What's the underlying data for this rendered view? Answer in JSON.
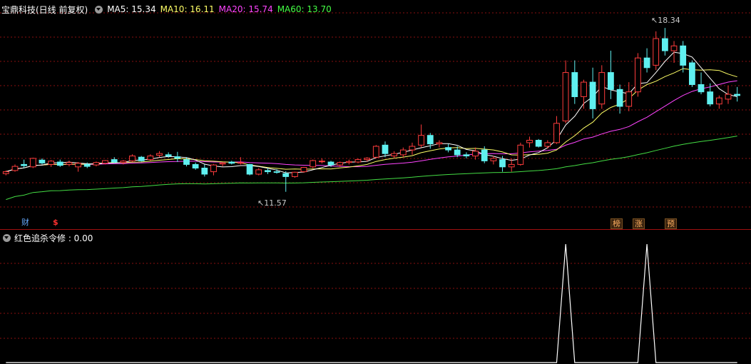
{
  "header": {
    "title": "宝鼎科技(日线 前复权)",
    "ma": [
      {
        "label": "MA5: 15.34",
        "color": "#ffffff"
      },
      {
        "label": "MA10: 16.11",
        "color": "#ffff66"
      },
      {
        "label": "MA20: 15.74",
        "color": "#ff44ff"
      },
      {
        "label": "MA60: 13.70",
        "color": "#44ff44"
      }
    ]
  },
  "annotations": {
    "high_label": "18.34",
    "low_label": "11.57",
    "bottom_markers": [
      {
        "text": "财",
        "color": "#66aaff",
        "style": "plain"
      },
      {
        "text": "$",
        "color": "#ff3030",
        "style": "plain"
      },
      {
        "text": "榜",
        "color": "#ffb060",
        "style": "box"
      },
      {
        "text": "涨",
        "color": "#ffb060",
        "style": "box"
      },
      {
        "text": "预",
        "color": "#ffb060",
        "style": "box"
      }
    ]
  },
  "indicator": {
    "label": "红色追杀令修 : 0.00",
    "value_color": "#ffffff"
  },
  "colors": {
    "up": "#ff3c3c",
    "down": "#5ff0f0",
    "grid": "#8a1010",
    "ma5": "#ffffff",
    "ma10": "#ffff66",
    "ma20": "#ff44ff",
    "ma60": "#44dd44"
  },
  "chart_data": {
    "type": "candlestick",
    "y_range": [
      10.5,
      19.2
    ],
    "candles": [
      [
        12.32,
        12.45,
        12.25,
        12.4
      ],
      [
        12.45,
        12.7,
        12.4,
        12.62
      ],
      [
        12.7,
        12.9,
        12.55,
        12.65
      ],
      [
        12.6,
        12.98,
        12.55,
        12.95
      ],
      [
        12.88,
        12.95,
        12.7,
        12.76
      ],
      [
        12.7,
        12.88,
        12.6,
        12.84
      ],
      [
        12.8,
        12.9,
        12.6,
        12.66
      ],
      [
        12.7,
        12.86,
        12.62,
        12.78
      ],
      [
        12.6,
        12.8,
        12.4,
        12.75
      ],
      [
        12.7,
        12.78,
        12.55,
        12.62
      ],
      [
        12.68,
        12.82,
        12.62,
        12.78
      ],
      [
        12.75,
        12.88,
        12.7,
        12.86
      ],
      [
        12.9,
        13.0,
        12.75,
        12.8
      ],
      [
        12.78,
        12.88,
        12.7,
        12.84
      ],
      [
        12.85,
        13.12,
        12.8,
        13.05
      ],
      [
        13.0,
        13.05,
        12.82,
        12.85
      ],
      [
        12.9,
        13.12,
        12.85,
        13.05
      ],
      [
        13.08,
        13.25,
        13.0,
        13.15
      ],
      [
        13.1,
        13.2,
        12.98,
        13.05
      ],
      [
        13.02,
        13.22,
        12.8,
        12.96
      ],
      [
        12.9,
        13.0,
        12.62,
        12.7
      ],
      [
        12.7,
        12.78,
        12.48,
        12.55
      ],
      [
        12.55,
        12.7,
        12.2,
        12.3
      ],
      [
        12.4,
        12.72,
        12.25,
        12.68
      ],
      [
        12.72,
        12.8,
        12.62,
        12.76
      ],
      [
        12.8,
        12.85,
        12.7,
        12.75
      ],
      [
        12.78,
        13.0,
        12.7,
        12.78
      ],
      [
        12.7,
        12.72,
        12.25,
        12.3
      ],
      [
        12.3,
        12.55,
        12.25,
        12.48
      ],
      [
        12.45,
        12.55,
        12.3,
        12.4
      ],
      [
        12.4,
        12.5,
        12.32,
        12.38
      ],
      [
        12.32,
        12.42,
        11.57,
        12.2
      ],
      [
        12.2,
        12.4,
        12.15,
        12.38
      ],
      [
        12.4,
        12.6,
        12.36,
        12.58
      ],
      [
        12.6,
        12.9,
        12.55,
        12.86
      ],
      [
        12.84,
        12.95,
        12.74,
        12.84
      ],
      [
        12.8,
        12.85,
        12.6,
        12.68
      ],
      [
        12.68,
        12.82,
        12.6,
        12.78
      ],
      [
        12.78,
        12.9,
        12.7,
        12.82
      ],
      [
        12.8,
        12.95,
        12.75,
        12.9
      ],
      [
        12.9,
        13.0,
        12.82,
        12.96
      ],
      [
        13.0,
        13.5,
        12.95,
        13.45
      ],
      [
        13.5,
        13.65,
        13.0,
        13.15
      ],
      [
        13.05,
        13.25,
        12.95,
        13.15
      ],
      [
        13.1,
        13.4,
        13.0,
        13.3
      ],
      [
        13.3,
        13.6,
        13.1,
        13.45
      ],
      [
        13.5,
        14.35,
        13.4,
        13.9
      ],
      [
        13.9,
        14.0,
        13.35,
        13.55
      ],
      [
        13.55,
        13.7,
        13.4,
        13.6
      ],
      [
        13.4,
        13.55,
        13.2,
        13.3
      ],
      [
        13.3,
        13.45,
        13.0,
        13.1
      ],
      [
        13.1,
        13.2,
        12.95,
        13.05
      ],
      [
        13.05,
        13.4,
        12.9,
        13.25
      ],
      [
        13.3,
        13.45,
        12.75,
        12.85
      ],
      [
        12.85,
        13.05,
        12.7,
        12.95
      ],
      [
        12.9,
        13.05,
        12.4,
        12.6
      ],
      [
        12.6,
        12.95,
        12.4,
        12.7
      ],
      [
        12.7,
        13.6,
        12.65,
        13.5
      ],
      [
        13.6,
        13.85,
        13.4,
        13.7
      ],
      [
        13.7,
        13.75,
        13.4,
        13.45
      ],
      [
        13.45,
        13.7,
        13.35,
        13.6
      ],
      [
        13.6,
        14.7,
        13.55,
        14.4
      ],
      [
        14.5,
        17.0,
        14.4,
        16.5
      ],
      [
        16.5,
        17.0,
        15.2,
        15.5
      ],
      [
        15.5,
        16.2,
        15.0,
        16.1
      ],
      [
        16.1,
        16.7,
        14.6,
        15.0
      ],
      [
        15.2,
        16.8,
        15.0,
        16.5
      ],
      [
        16.5,
        17.4,
        15.4,
        15.8
      ],
      [
        15.8,
        16.0,
        14.8,
        15.1
      ],
      [
        15.1,
        16.1,
        14.9,
        15.7
      ],
      [
        15.7,
        17.3,
        15.5,
        17.1
      ],
      [
        17.1,
        17.5,
        16.5,
        16.7
      ],
      [
        16.8,
        18.2,
        16.6,
        17.9
      ],
      [
        17.9,
        18.34,
        17.2,
        17.4
      ],
      [
        17.4,
        17.8,
        16.9,
        17.6
      ],
      [
        17.6,
        17.8,
        16.5,
        16.8
      ],
      [
        16.9,
        17.0,
        15.9,
        16.0
      ],
      [
        16.0,
        16.5,
        15.6,
        15.7
      ],
      [
        15.7,
        16.05,
        15.1,
        15.2
      ],
      [
        15.2,
        15.55,
        15.0,
        15.45
      ],
      [
        15.4,
        15.95,
        15.2,
        15.6
      ],
      [
        15.6,
        15.9,
        15.3,
        15.55
      ]
    ],
    "indicator": {
      "type": "line",
      "y_range": [
        0,
        1
      ],
      "values": [
        0,
        0,
        0,
        0,
        0,
        0,
        0,
        0,
        0,
        0,
        0,
        0,
        0,
        0,
        0,
        0,
        0,
        0,
        0,
        0,
        0,
        0,
        0,
        0,
        0,
        0,
        0,
        0,
        0,
        0,
        0,
        0,
        0,
        0,
        0,
        0,
        0,
        0,
        0,
        0,
        0,
        0,
        0,
        0,
        0,
        0,
        0,
        0,
        0,
        0,
        0,
        0,
        0,
        0,
        0,
        0,
        0,
        0,
        0,
        0,
        0,
        0,
        1,
        0,
        0,
        0,
        0,
        0,
        0,
        0,
        0,
        1,
        0,
        0,
        0,
        0,
        0,
        0,
        0,
        0,
        0,
        0
      ]
    }
  }
}
